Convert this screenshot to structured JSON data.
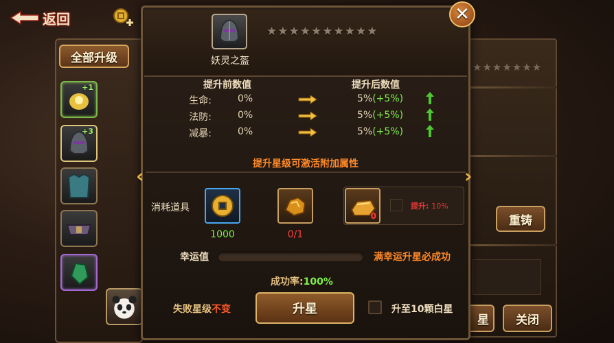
{
  "top_bar": {
    "back_label": "返回"
  },
  "left_panel": {
    "upgrade_all_label": "全部升级",
    "slot_bonuses": [
      "+1",
      "+3"
    ]
  },
  "right_panel": {
    "recast_label": "重铸",
    "close_label": "关闭",
    "partial_button_label": "星"
  },
  "dialog": {
    "item_name": "妖灵之盔",
    "stars": {
      "current": 0,
      "max": 10
    },
    "bg_stars": {
      "max": 7
    },
    "before_header": "提升前数值",
    "after_header": "提升后数值",
    "stats": [
      {
        "label": "生命:",
        "before": "0%",
        "after": "5%",
        "bonus": "(+5%)"
      },
      {
        "label": "法防:",
        "before": "0%",
        "after": "5%",
        "bonus": "(+5%)"
      },
      {
        "label": "减暴:",
        "before": "0%",
        "after": "5%",
        "bonus": "(+5%)"
      }
    ],
    "activate_hint": "提升星级可激活附加属性",
    "consume_label": "消耗道具",
    "materials": [
      {
        "icon": "copper-coin-icon",
        "count": "1000"
      },
      {
        "icon": "gold-ore-icon",
        "count": "0/1"
      }
    ],
    "protect_item": {
      "icon": "gold-ingot-icon",
      "count": "0",
      "label": "提升:",
      "percent": "10%"
    },
    "luck_label": "幸运值",
    "luck_fill": 0.0,
    "luck_hint": "满幸运升星必成功",
    "success_label": "成功率:",
    "success_value": "100%",
    "fail_text": "失败星级",
    "fail_warn": "不变",
    "upstar_label": "升星",
    "ten_white_label": "升至10颗白星"
  },
  "colors": {
    "accent_orange": "#ff8a2a",
    "bonus_green": "#7ef04a",
    "warn_red": "#e23838",
    "gold_border": "#e0b468"
  }
}
